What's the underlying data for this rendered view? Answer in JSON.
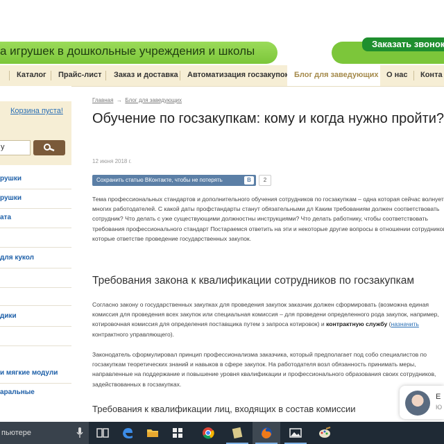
{
  "header": {
    "slogan": "а игрушек в дошкольные учреждения и школы",
    "order_button": "Заказать звонок"
  },
  "nav": {
    "items": [
      {
        "label": "Каталог"
      },
      {
        "label": "Прайс-лист"
      },
      {
        "label": "Заказ и доставка"
      },
      {
        "label": "Автоматизация госзакупок"
      },
      {
        "label": "Блог для заведующих",
        "active": true
      },
      {
        "label": "О нас"
      },
      {
        "label": "Конта"
      }
    ]
  },
  "sidebar": {
    "cart_label": "Корзина пуста!",
    "search_value": "у",
    "categories": [
      "рушки",
      "рушки",
      "ата",
      "для кукол",
      "дики",
      "и мягкие модули",
      "аральные"
    ]
  },
  "article": {
    "breadcrumb_home": "Главная",
    "breadcrumb_arrow": "→",
    "breadcrumb_section": "Блог для заведующих",
    "title": "Обучение по госзакупкам: кому и когда нужно пройти?",
    "date": "12 июня 2018 г.",
    "vk_share": "Сохранить статью ВКонтакте, чтобы не потерять",
    "vk_letter": "В",
    "vk_count": "2",
    "intro": "Тема профессиональных стандартов и дополнительного обучения сотрудников по госзакупкам – одна которая сейчас волнует многих работодателей. С какой даты профстандарты станут обязательными дл Каким требованиям должен соответствовать сотрудник? Что делать с уже существующими должностны инструкциями? Что делать работнику, чтобы соответствовать требования профессионального стандарт Постараемся ответить на эти и некоторые другие вопросы в отношении сотрудников, которые ответстве проведение государственных закупок.",
    "h2": "Требования закона к квалификации сотрудников по госзакупкам",
    "p2_part1": "Согласно закону о государственных закупках для проведения закупок заказчик должен сформировать (возможна единая комиссия для проведения всех закупок или специальная комиссия – для проведени определенного рода закупок, например, котировочная комиссия для определения поставщика путем з запроса котировок) и ",
    "p2_bold": "контрактную службу",
    "p2_part2": " (",
    "p2_link": "назначить",
    "p2_part3": " контрактного управляющего).",
    "p3": "Законодатель сформулировал принцип профессионализма заказчика, который предполагает под собо специалистов по госзакупкам теоретических знаний и навыков в сфере закупок. На работодателя возл обязанность принимать меры, направленные на поддержание и повышение уровня квалификации и профессионального образования своих сотрудников, задействованных в госзакупках.",
    "h3": "Требования к квалификации лиц, входящих в состав комиссии"
  },
  "chat": {
    "initial": "Е",
    "sub": "Ю"
  },
  "taskbar": {
    "search_text": "пьютере"
  }
}
